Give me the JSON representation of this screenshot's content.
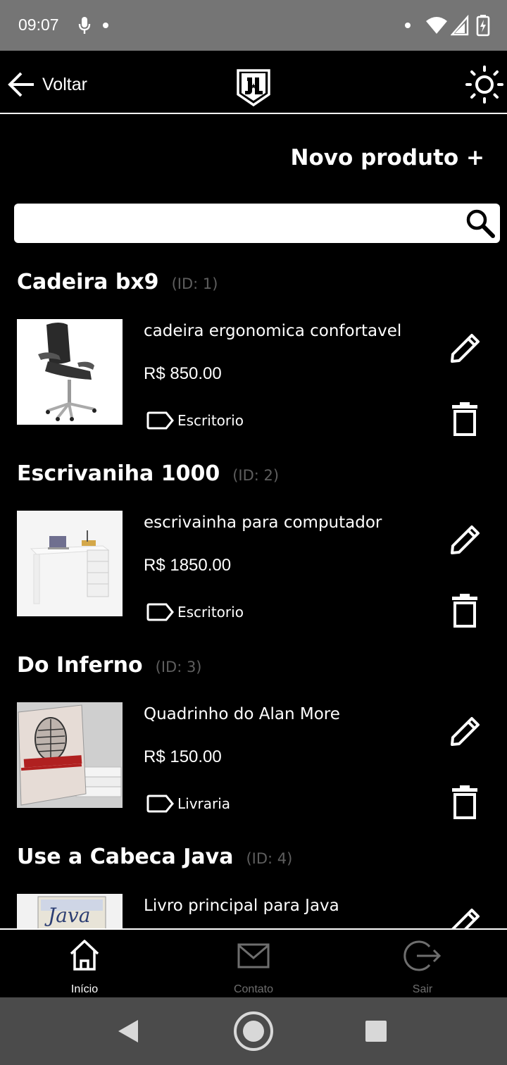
{
  "status_bar": {
    "time": "09:07"
  },
  "app_bar": {
    "back_label": "Voltar",
    "logo_text": "JL"
  },
  "actions": {
    "new_product": "Novo produto +"
  },
  "search": {
    "value": "",
    "placeholder": ""
  },
  "products": [
    {
      "name": "Cadeira bx9",
      "id_label": "(ID: 1)",
      "description": "cadeira ergonomica confortavel",
      "price": "R$ 850.00",
      "category": "Escritorio"
    },
    {
      "name": "Escrivaniha 1000",
      "id_label": "(ID: 2)",
      "description": "escrivainha para computador",
      "price": "R$ 1850.00",
      "category": "Escritorio"
    },
    {
      "name": "Do Inferno",
      "id_label": "(ID: 3)",
      "description": "Quadrinho do Alan More",
      "price": "R$ 150.00",
      "category": "Livraria"
    },
    {
      "name": "Use a Cabeca Java",
      "id_label": "(ID: 4)",
      "description": "Livro principal para Java",
      "price": "",
      "category": ""
    }
  ],
  "bottom_nav": {
    "items": [
      {
        "label": "Início",
        "icon": "home-icon",
        "active": true
      },
      {
        "label": "Contato",
        "icon": "mail-icon",
        "active": false
      },
      {
        "label": "Sair",
        "icon": "logout-icon",
        "active": false
      }
    ]
  },
  "colors": {
    "background": "#000000",
    "status_bar": "#757575",
    "system_nav": "#4b4b4b",
    "muted_text": "#5e5e5e",
    "inactive_nav": "#6e6e6e"
  }
}
